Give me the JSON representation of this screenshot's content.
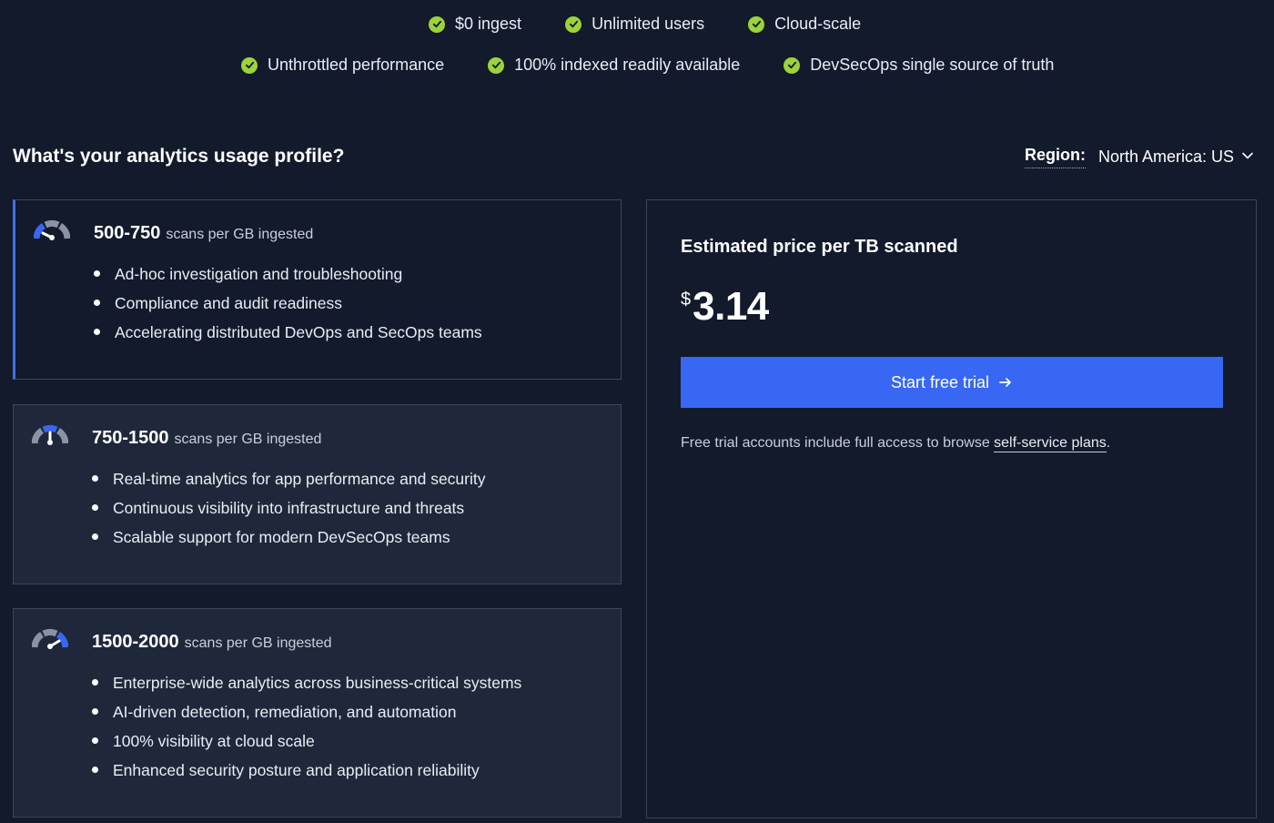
{
  "features": {
    "row1": [
      "$0 ingest",
      "Unlimited users",
      "Cloud-scale"
    ],
    "row2": [
      "Unthrottled performance",
      "100% indexed readily available",
      "DevSecOps single source of truth"
    ]
  },
  "heading": "What's your analytics usage profile?",
  "region": {
    "label": "Region:",
    "value": "North America: US"
  },
  "profiles": [
    {
      "range": "500-750",
      "unit": "scans per GB ingested",
      "items": [
        "Ad-hoc investigation and troubleshooting",
        "Compliance and audit readiness",
        "Accelerating distributed DevOps and SecOps teams"
      ]
    },
    {
      "range": "750-1500",
      "unit": "scans per GB ingested",
      "items": [
        "Real-time analytics for app performance and security",
        "Continuous visibility into infrastructure and threats",
        "Scalable support for modern DevSecOps teams"
      ]
    },
    {
      "range": "1500-2000",
      "unit": "scans per GB ingested",
      "items": [
        "Enterprise-wide analytics across business-critical systems",
        "AI-driven detection, remediation, and automation",
        "100% visibility at cloud scale",
        "Enhanced security posture and application reliability"
      ]
    }
  ],
  "price": {
    "title": "Estimated price per TB scanned",
    "currency": "$",
    "amount": "3.14",
    "cta_label": "Start free trial",
    "note_prefix": "Free trial accounts include full access to browse ",
    "note_link": "self-service plans",
    "note_suffix": "."
  },
  "colors": {
    "background": "#121a2b",
    "card": "#1e283a",
    "accent": "#3867f4",
    "check": "#9bd339"
  }
}
